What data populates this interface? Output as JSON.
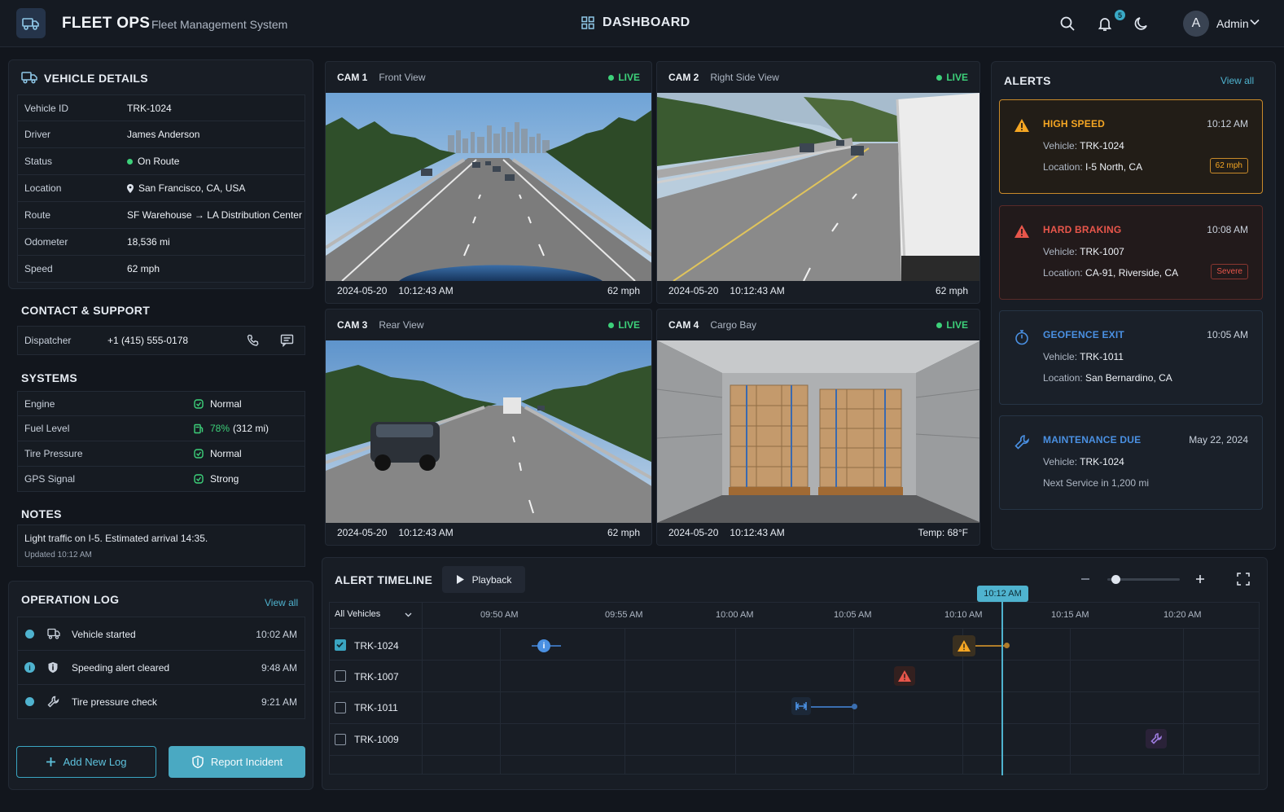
{
  "header": {
    "brand": "FLEET OPS",
    "subtitle": "Fleet Management System",
    "page_title": "DASHBOARD",
    "notification_count": "5",
    "avatar_letter": "A",
    "user_name": "Admin"
  },
  "vehicle": {
    "title": "VEHICLE DETAILS",
    "rows": [
      {
        "k": "Vehicle ID",
        "v": "TRK-1024"
      },
      {
        "k": "Driver",
        "v": "James Anderson"
      },
      {
        "k": "Status",
        "v": "On Route"
      },
      {
        "k": "Location",
        "v": "San Francisco, CA, USA"
      },
      {
        "k": "Route",
        "v": "SF Warehouse → LA Distribution Center"
      },
      {
        "k": "Odometer",
        "v": "18,536 mi"
      },
      {
        "k": "Speed",
        "v": "62 mph"
      }
    ]
  },
  "contact": {
    "title": "CONTACT & SUPPORT",
    "label": "Dispatcher",
    "phone": "+1 (415) 555-0178"
  },
  "systems": {
    "title": "SYSTEMS",
    "rows": [
      {
        "k": "Engine",
        "v": "Normal"
      },
      {
        "k": "Fuel Level",
        "pct": "78%",
        "v": "(312 mi)"
      },
      {
        "k": "Tire Pressure",
        "v": "Normal"
      },
      {
        "k": "GPS Signal",
        "v": "Strong"
      }
    ]
  },
  "notes": {
    "title": "NOTES",
    "text": "Light traffic on I-5. Estimated arrival 14:35.",
    "updated": "Updated 10:12 AM"
  },
  "oplog": {
    "title": "OPERATION LOG",
    "view_all": "View all",
    "rows": [
      {
        "label": "Vehicle started",
        "time": "10:02 AM"
      },
      {
        "label": "Speeding alert cleared",
        "time": "9:48 AM"
      },
      {
        "label": "Tire pressure check",
        "time": "9:21 AM"
      }
    ],
    "add_button": "Add New Log",
    "report_button": "Report Incident"
  },
  "cameras": [
    {
      "id": "CAM 1",
      "name": "Front View",
      "live": "LIVE",
      "date": "2024-05-20",
      "time": "10:12:43 AM",
      "right": "62 mph"
    },
    {
      "id": "CAM 2",
      "name": "Right Side View",
      "live": "LIVE",
      "date": "2024-05-20",
      "time": "10:12:43 AM",
      "right": "62 mph"
    },
    {
      "id": "CAM 3",
      "name": "Rear View",
      "live": "LIVE",
      "date": "2024-05-20",
      "time": "10:12:43 AM",
      "right": "62 mph"
    },
    {
      "id": "CAM 4",
      "name": "Cargo Bay",
      "live": "LIVE",
      "date": "2024-05-20",
      "time": "10:12:43 AM",
      "right": "Temp: 68°F"
    }
  ],
  "alerts": {
    "title": "ALERTS",
    "view_all": "View all",
    "items": [
      {
        "title": "HIGH SPEED",
        "time": "10:12 AM",
        "vehicle_label": "Vehicle:",
        "vehicle": "TRK-1024",
        "l2_label": "Location:",
        "l2": "I-5 North, CA",
        "tag": "62 mph",
        "color": "#f5a623"
      },
      {
        "title": "HARD BRAKING",
        "time": "10:08 AM",
        "vehicle_label": "Vehicle:",
        "vehicle": "TRK-1007",
        "l2_label": "Location:",
        "l2": "CA-91, Riverside, CA",
        "tag": "Severe",
        "color": "#e8564b"
      },
      {
        "title": "GEOFENCE EXIT",
        "time": "10:05 AM",
        "vehicle_label": "Vehicle:",
        "vehicle": "TRK-1011",
        "l2_label": "Location:",
        "l2": "San Bernardino, CA",
        "color": "#4a90e2"
      },
      {
        "title": "MAINTENANCE DUE",
        "time": "May 22, 2024",
        "vehicle_label": "Vehicle:",
        "vehicle": "TRK-1024",
        "l2_label": "",
        "l2": "Next Service in 1,200 mi",
        "color": "#4a90e2"
      }
    ]
  },
  "timeline": {
    "title": "ALERT TIMELINE",
    "playback": "Playback",
    "filter": "All Vehicles",
    "current": "10:12 AM",
    "ticks": [
      "09:50 AM",
      "09:55 AM",
      "10:00 AM",
      "10:05 AM",
      "10:10 AM",
      "10:15 AM",
      "10:20 AM"
    ],
    "vehicles": [
      {
        "id": "TRK-1024",
        "checked": true
      },
      {
        "id": "TRK-1007",
        "checked": false
      },
      {
        "id": "TRK-1011",
        "checked": false
      },
      {
        "id": "TRK-1009",
        "checked": false
      }
    ]
  },
  "colors": {
    "accent": "#4aa9c2",
    "live": "#3dd17a",
    "warning": "#f5a623",
    "danger": "#e8564b",
    "info": "#4a90e2"
  }
}
